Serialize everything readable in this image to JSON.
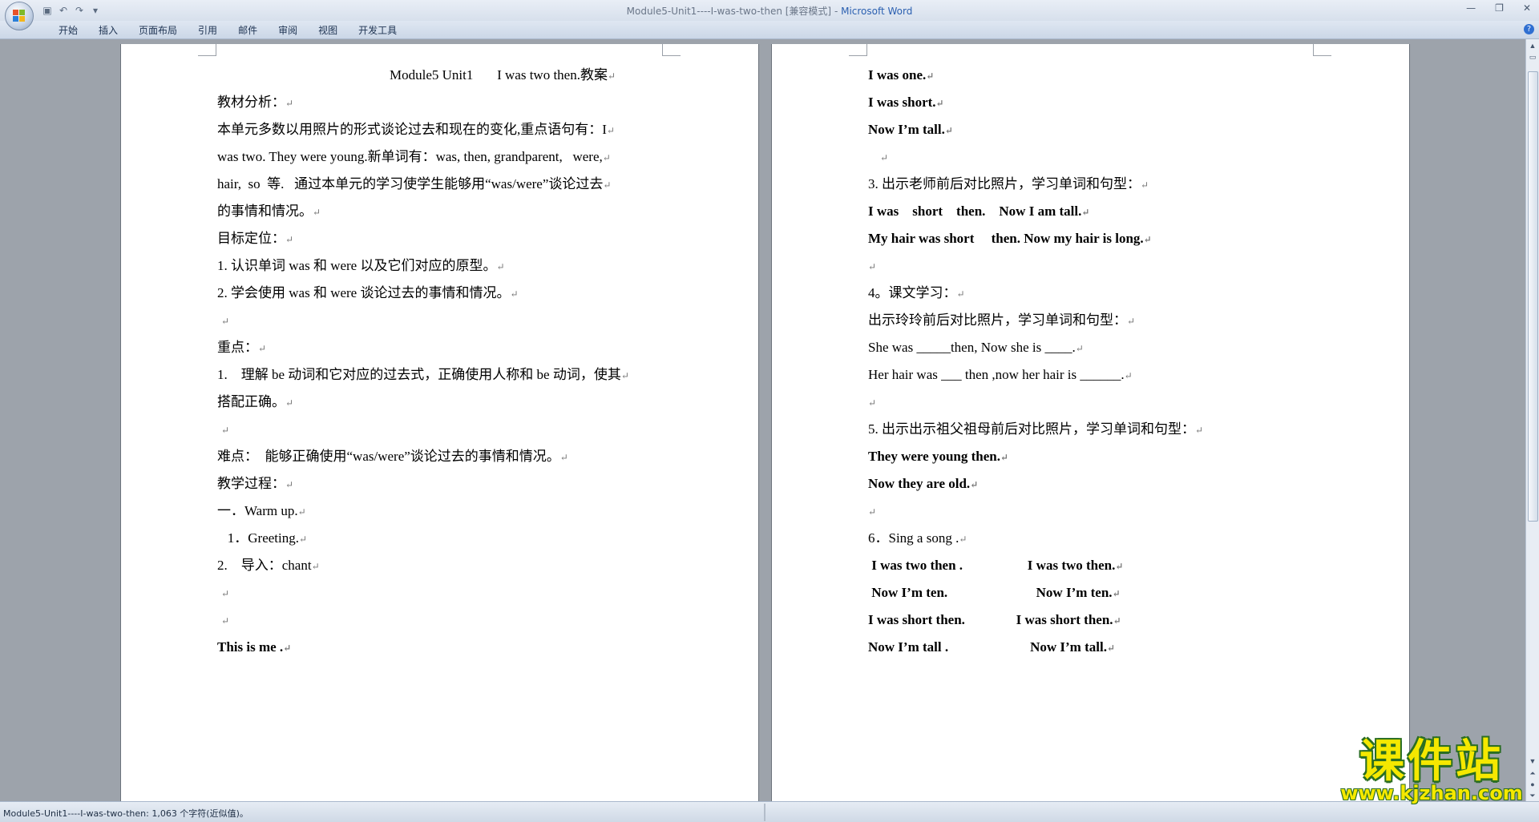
{
  "window": {
    "title_doc": "Module5-Unit1----I-was-two-then [兼容模式]",
    "title_sep": " - ",
    "title_app": "Microsoft Word"
  },
  "qat": {
    "save_icon": "save-icon",
    "undo_icon": "undo-icon",
    "redo_icon": "redo-icon",
    "more": "▾"
  },
  "ribbon_tabs": [
    "开始",
    "插入",
    "页面布局",
    "引用",
    "邮件",
    "审阅",
    "视图",
    "开发工具"
  ],
  "window_controls": {
    "minimize": "—",
    "maximize": "❐",
    "close": "✕"
  },
  "help": "?",
  "left_page": [
    "Module5 Unit1       I was two then.教案",
    "教材分析：",
    "本单元多数以用照片的形式谈论过去和现在的变化,重点语句有：I",
    "was two. They were young.新单词有：was, then, grandparent,   were,",
    "hair,  so  等.   通过本单元的学习使学生能够用“was/were”谈论过去",
    "的事情和情况。",
    "目标定位：",
    "1. 认识单词 was 和 were 以及它们对应的原型。",
    "2. 学会使用 was 和 were 谈论过去的事情和情况。",
    "",
    "重点：",
    "1.    理解 be 动词和它对应的过去式，正确使用人称和 be 动词，使其",
    "搭配正确。",
    "",
    "难点：  能够正确使用“was/were”谈论过去的事情和情况。",
    "教学过程：",
    "一．Warm up.",
    "   1．Greeting.",
    "2.    导入：chant",
    "",
    "",
    "This is me ."
  ],
  "right_page": [
    "I was one.",
    "I was short.",
    "Now I’m tall.",
    "",
    "3. 出示老师前后对比照片，学习单词和句型：",
    "I was    short    then.    Now I am tall.",
    "My hair was short     then. Now my hair is long.",
    "",
    "4。课文学习：",
    "出示玲玲前后对比照片，学习单词和句型：",
    "She was _____then, Now she is ____.",
    "Her hair was ___ then ,now her hair is ______.",
    "",
    "5. 出示出示祖父祖母前后对比照片，学习单词和句型：",
    "They were young then.",
    "Now they are old.",
    "",
    "6．Sing a song .",
    " I was two then .                   I was two then.",
    " Now I’m ten.                          Now I’m ten.",
    "I was short then.               I was short then.",
    "Now I’m tall .                        Now I’m tall."
  ],
  "paragraph_mark": "↵",
  "status_text": "Module5-Unit1----I-was-two-then: 1,063 个字符(近似值)。",
  "watermark": {
    "title": "课件站",
    "url": "www.kjzhan.com"
  }
}
